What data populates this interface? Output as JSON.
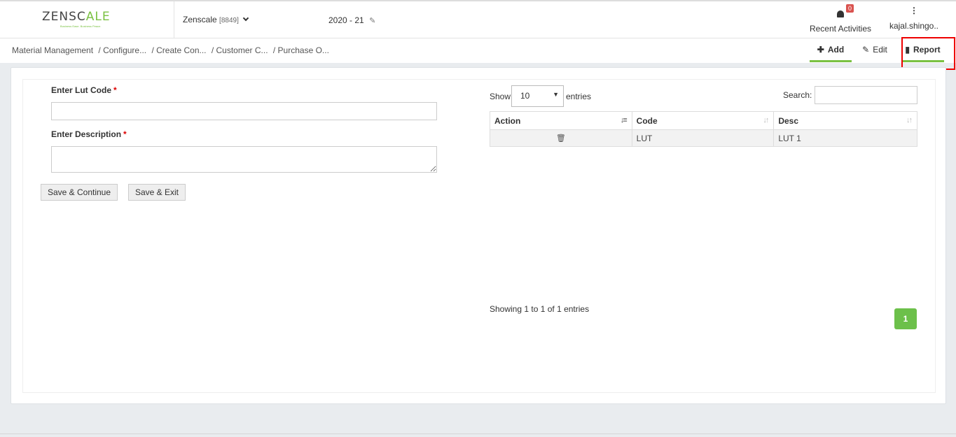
{
  "header": {
    "logo": {
      "main_left": "ZENSC",
      "main_accent": "A",
      "main_right": "LE",
      "tagline": "Business Ease. Business Peace."
    },
    "company_name": "Zenscale",
    "company_code": "[8849]",
    "fiscal_year": "2020 - 21",
    "notifications": {
      "count": "0",
      "label": "Recent Activities"
    },
    "user": {
      "name": "kajal.shingo.."
    }
  },
  "breadcrumb": [
    "Material Management",
    "/ Configure...",
    "/ Create Con...",
    "/ Customer C...",
    "/ Purchase O..."
  ],
  "toolbar": {
    "add_label": "Add",
    "edit_label": "Edit",
    "report_label": "Report"
  },
  "form": {
    "lut_code_label": "Enter Lut Code",
    "lut_code_value": "",
    "description_label": "Enter Description",
    "description_value": "",
    "required_mark": "*",
    "save_continue_label": "Save & Continue",
    "save_exit_label": "Save & Exit"
  },
  "table": {
    "show_label": "Show",
    "entries_label": "entries",
    "page_size": "10",
    "search_label": "Search:",
    "search_value": "",
    "columns": [
      "Action",
      "Code",
      "Desc"
    ],
    "rows": [
      {
        "code": "LUT",
        "desc": "LUT 1"
      }
    ],
    "info": "Showing 1 to 1 of 1 entries",
    "current_page": "1"
  },
  "colors": {
    "accent": "#7ac142",
    "highlight_box": "#e00000",
    "badge": "#d9534f"
  }
}
